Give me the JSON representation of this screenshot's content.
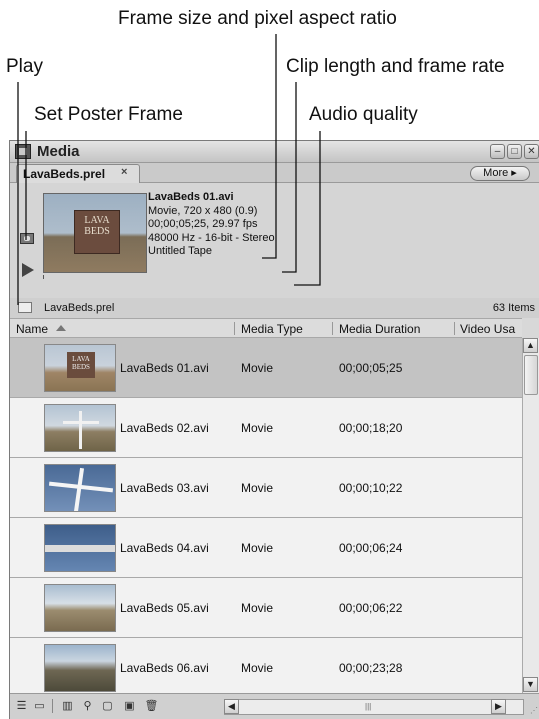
{
  "callouts": {
    "frame_size": "Frame size and pixel aspect ratio",
    "play": "Play",
    "clip_length": "Clip length and frame rate",
    "poster": "Set Poster Frame",
    "audio": "Audio quality"
  },
  "panel": {
    "title": "Media",
    "tab_label": "LavaBeds.prel",
    "tab_close": "×",
    "more_label": "More ▸",
    "window_buttons": [
      "minimize-icon",
      "maximize-icon",
      "close-icon"
    ]
  },
  "preview": {
    "filename": "LavaBeds 01.avi",
    "info_line1": "Movie, 720 x 480 (0.9)",
    "info_line2": "00;00;05;25, 29.97 fps",
    "info_line3": "48000 Hz - 16-bit - Stereo",
    "info_line4": "Untitled Tape",
    "sign_line1": "LAVA",
    "sign_line2": "BEDS"
  },
  "bin": {
    "label": "LavaBeds.prel",
    "item_count": "63 Items"
  },
  "columns": {
    "name": "Name",
    "media_type": "Media Type",
    "media_duration": "Media Duration",
    "video_usage": "Video Usa"
  },
  "rows": [
    {
      "name": "LavaBeds 01.avi",
      "type": "Movie",
      "duration": "00;00;05;25",
      "selected": true
    },
    {
      "name": "LavaBeds 02.avi",
      "type": "Movie",
      "duration": "00;00;18;20",
      "selected": false
    },
    {
      "name": "LavaBeds 03.avi",
      "type": "Movie",
      "duration": "00;00;10;22",
      "selected": false
    },
    {
      "name": "LavaBeds 04.avi",
      "type": "Movie",
      "duration": "00;00;06;24",
      "selected": false
    },
    {
      "name": "LavaBeds 05.avi",
      "type": "Movie",
      "duration": "00;00;06;22",
      "selected": false
    },
    {
      "name": "LavaBeds 06.avi",
      "type": "Movie",
      "duration": "00;00;23;28",
      "selected": false
    }
  ],
  "icons": {
    "list_view": "list-view-icon",
    "icon_view": "icon-view-icon",
    "automate": "automate-to-sequence-icon",
    "find": "find-icon",
    "new_bin": "new-bin-icon",
    "new_item": "new-item-icon",
    "clear": "trash-icon"
  },
  "colors": {
    "panel_bg": "#d8d8d8",
    "selected_row": "#c3c3c3",
    "row_bg": "#f2f2f2"
  }
}
